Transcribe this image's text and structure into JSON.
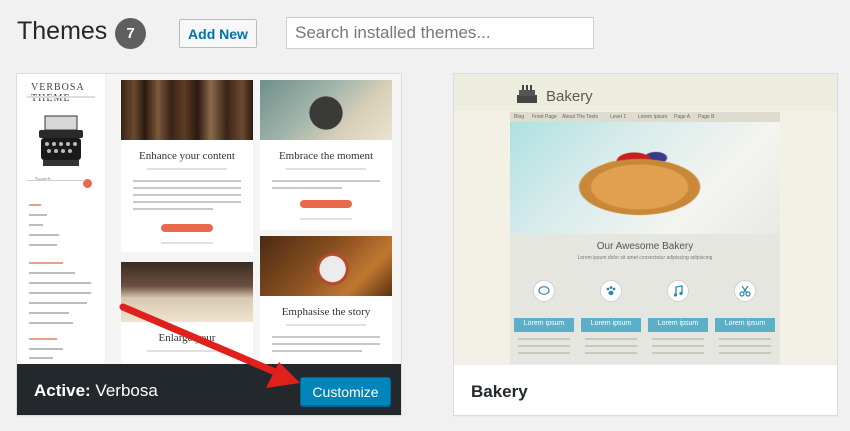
{
  "header": {
    "title": "Themes",
    "count": "7",
    "add_new_label": "Add New",
    "search_placeholder": "Search installed themes..."
  },
  "themes": [
    {
      "name": "Verbosa",
      "active_label": "Active:",
      "customize_label": "Customize",
      "preview": {
        "logo": "VERBOSA THEME",
        "search_label": "Search",
        "posts": [
          "Enhance your content",
          "Embrace the moment",
          "Enlarge your",
          "Emphasise the story"
        ]
      }
    },
    {
      "name": "Bakery",
      "preview": {
        "logo": "Bakery",
        "nav": [
          "Blog",
          "Front Page",
          "About The Tests",
          "Level 1",
          "Lorem Ipsum",
          "Page A",
          "Page B"
        ],
        "section_title": "Our Awesome Bakery",
        "section_sub": "Lorem ipsum dolor sit amet consectetur adipiscing adipiscing",
        "columns": [
          "Lorem ipsum",
          "Lorem ipsum",
          "Lorem ipsum",
          "Lorem ipsum"
        ]
      }
    }
  ],
  "colors": {
    "accent": "#0085ba",
    "link": "#0073aa",
    "active_bar": "#23282d",
    "arrow": "#e0201a"
  }
}
